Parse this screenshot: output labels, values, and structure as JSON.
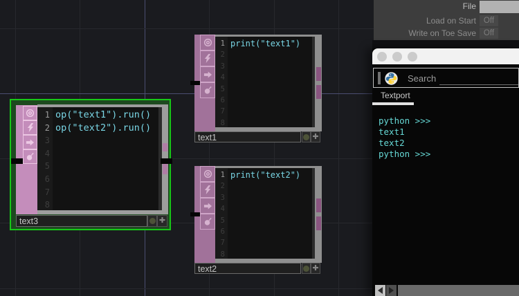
{
  "editor": {
    "background": "#1a1b1f",
    "grid_minor_color": "#27282d",
    "grid_major_color": "#4b4e72"
  },
  "gutter_numbers": [
    "1",
    "2",
    "3",
    "4",
    "5",
    "6",
    "7",
    "8"
  ],
  "node_icons": [
    "viewer-toggle-icon",
    "bypass-lightning-icon",
    "run-arrow-icon",
    "bomb-icon"
  ],
  "nodes": [
    {
      "name": "text3",
      "selected": true,
      "code": [
        "op(\"text1\").run()",
        "op(\"text2\").run()"
      ]
    },
    {
      "name": "text1",
      "selected": false,
      "code": [
        "print(\"text1\")"
      ]
    },
    {
      "name": "text2",
      "selected": false,
      "code": [
        "print(\"text2\")"
      ]
    }
  ],
  "param_dialog": {
    "file_label": "File",
    "file_value": "",
    "rows": [
      {
        "label": "Load on Start",
        "value": "Off"
      },
      {
        "label": "Write on Toe Save",
        "value": "Off"
      }
    ]
  },
  "textport": {
    "search_label": "Search",
    "tab_label": "Textport",
    "console_lines": [
      "python >>>",
      "text1",
      "text2",
      "python >>>"
    ],
    "console_text_color": "#66d8d5",
    "window_buttons": 3
  }
}
